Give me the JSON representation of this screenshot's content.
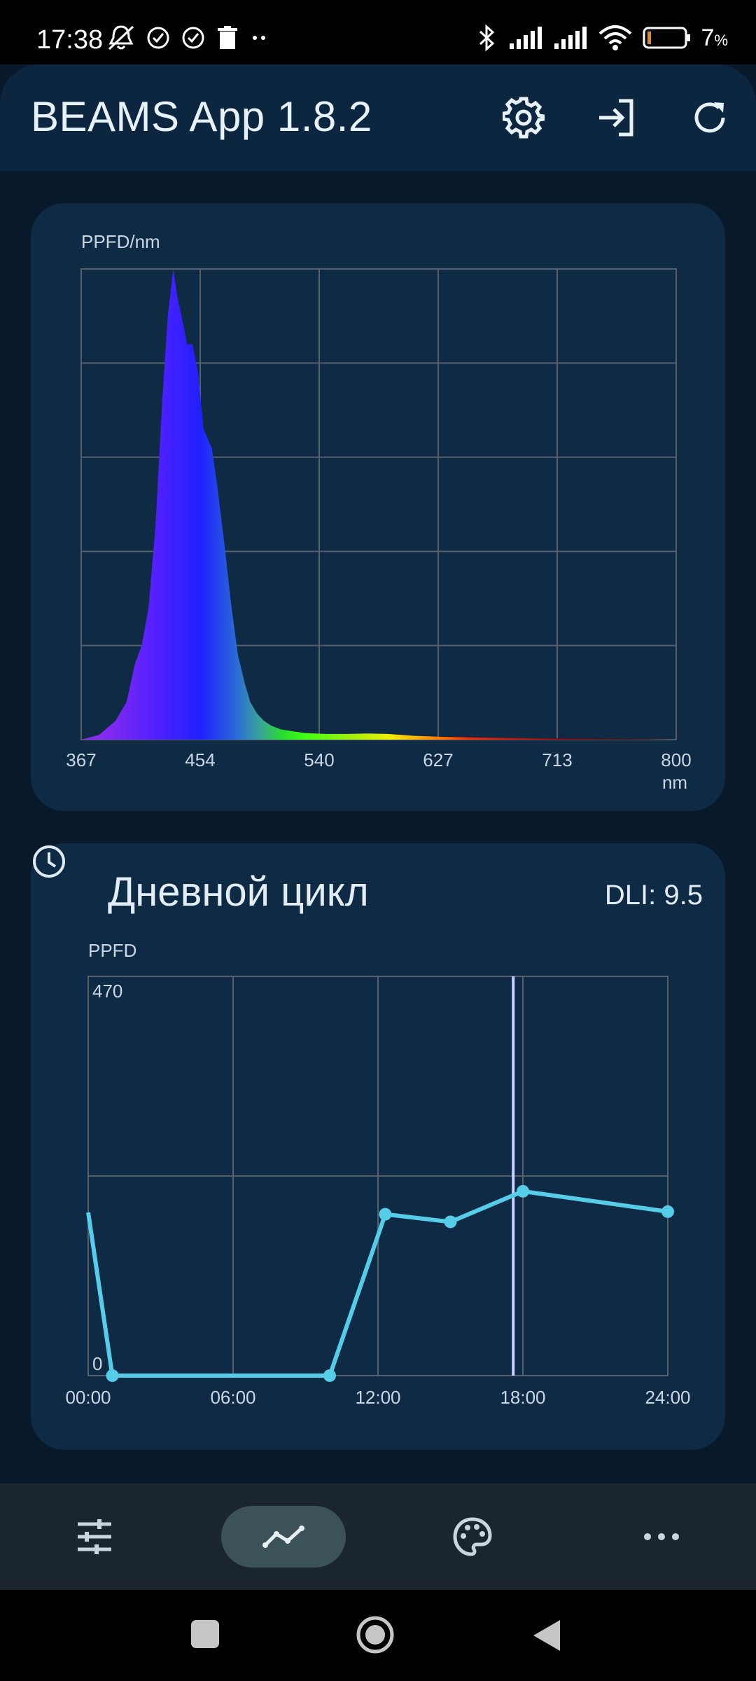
{
  "status_bar": {
    "time": "17:38",
    "battery_value": "7",
    "battery_unit": "%"
  },
  "app_bar": {
    "title": "BEAMS App 1.8.2",
    "icons": [
      "settings-gear-icon",
      "login-arrow-icon",
      "refresh-icon"
    ]
  },
  "spectrum_card": {
    "chart_data": {
      "type": "area",
      "ylabel": "PPFD/nm",
      "xlabel": "nm",
      "x_ticks": [
        "367",
        "454",
        "540",
        "627",
        "713",
        "800"
      ],
      "xlim": [
        367,
        800
      ],
      "ylim": [
        0,
        1
      ],
      "grid": true,
      "color_gradient": "wavelength spectrum (violet-blue-green-yellow-red)",
      "x": [
        367,
        380,
        392,
        400,
        406,
        411,
        416,
        421,
        426,
        430,
        434,
        437,
        440,
        444,
        448,
        452,
        456,
        462,
        466,
        471,
        476,
        481,
        486,
        490,
        495,
        500,
        505,
        512,
        520,
        530,
        545,
        560,
        575,
        590,
        600,
        610,
        630,
        660,
        700,
        740,
        780,
        800
      ],
      "y": [
        0.0,
        0.01,
        0.04,
        0.08,
        0.16,
        0.2,
        0.28,
        0.45,
        0.72,
        0.9,
        1.0,
        0.94,
        0.9,
        0.84,
        0.84,
        0.78,
        0.66,
        0.62,
        0.54,
        0.42,
        0.29,
        0.18,
        0.12,
        0.08,
        0.055,
        0.04,
        0.03,
        0.022,
        0.018,
        0.014,
        0.012,
        0.012,
        0.013,
        0.012,
        0.01,
        0.008,
        0.006,
        0.004,
        0.003,
        0.002,
        0.001,
        0.0
      ]
    }
  },
  "day_cycle_card": {
    "title": "Дневной цикл",
    "icon": "clock-icon",
    "dli_text": "DLI: 9.5",
    "chart_data": {
      "type": "line",
      "ylabel": "PPFD",
      "y_ticks": [
        "470",
        "0"
      ],
      "x_ticks": [
        "00:00",
        "06:00",
        "12:00",
        "18:00",
        "24:00"
      ],
      "xlim": [
        0,
        24
      ],
      "ylim": [
        0,
        470
      ],
      "grid": true,
      "line_color": "#55cde9",
      "current_time_marker": 17.6,
      "x": [
        0.0,
        1.0,
        10.0,
        12.3,
        15.0,
        18.0,
        24.0
      ],
      "y": [
        192,
        0,
        0,
        190,
        181,
        217,
        193
      ],
      "points_with_markers": [
        1,
        2,
        3,
        4,
        5,
        6
      ]
    }
  },
  "bottom_nav": {
    "items": [
      "sliders-icon",
      "chart-line-icon",
      "palette-icon",
      "more-icon"
    ],
    "active_index": 1
  },
  "system_nav": [
    "recents-square-icon",
    "home-circle-icon",
    "back-triangle-icon"
  ]
}
